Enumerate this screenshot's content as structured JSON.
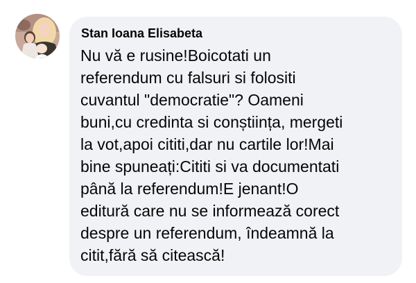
{
  "comment": {
    "author": "Stan Ioana Elisabeta",
    "lines": [
      "Nu vă e rusine!Boicotati un",
      "referendum cu falsuri si folositi",
      "cuvantul \"democratie\"? Oameni",
      "buni,cu credinta si conștiința, mergeti",
      "la vot,apoi cititi,dar nu cartile lor!Mai",
      "bine spuneați:Cititi si va documentati",
      "până la referendum!E jenant!O",
      "editură care nu se informează corect",
      "despre un referendum, îndeamnă la",
      "citit,fără să citească!"
    ]
  },
  "colors": {
    "bubble_background": "#f0f2f5",
    "text": "#050505"
  }
}
